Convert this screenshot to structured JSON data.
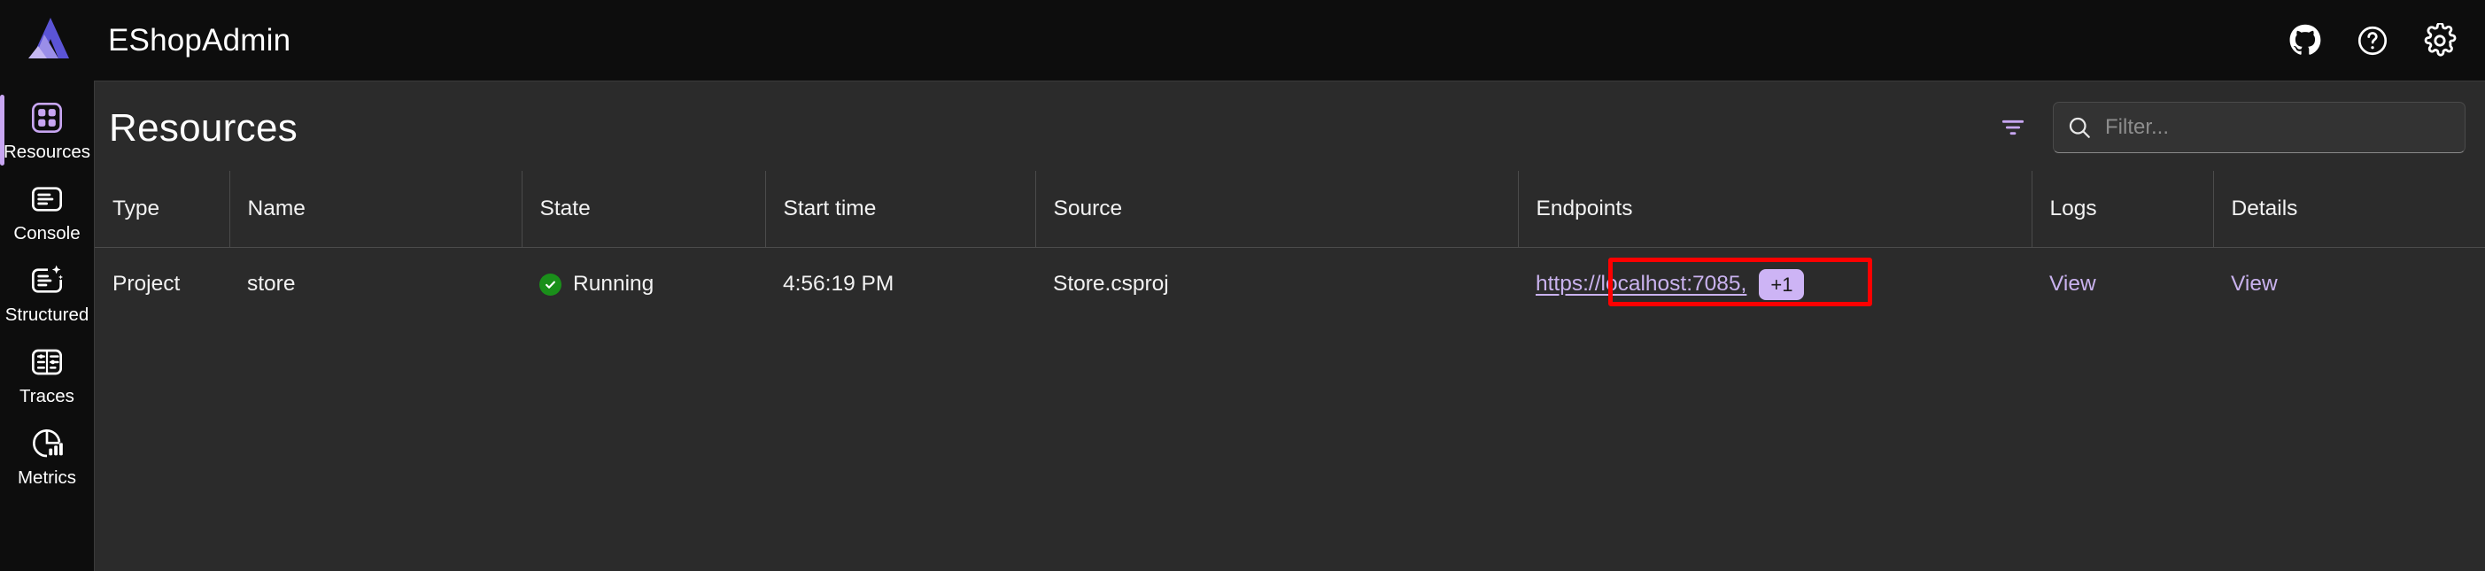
{
  "header": {
    "app_title": "EShopAdmin",
    "logo_name": "aspire-logo",
    "actions": [
      {
        "name": "github-icon",
        "label": "GitHub"
      },
      {
        "name": "help-icon",
        "label": "Help"
      },
      {
        "name": "settings-icon",
        "label": "Settings"
      }
    ]
  },
  "sidebar": {
    "items": [
      {
        "label": "Resources",
        "icon": "resources-icon",
        "active": true
      },
      {
        "label": "Console",
        "icon": "console-icon",
        "active": false
      },
      {
        "label": "Structured",
        "icon": "structured-icon",
        "active": false
      },
      {
        "label": "Traces",
        "icon": "traces-icon",
        "active": false
      },
      {
        "label": "Metrics",
        "icon": "metrics-icon",
        "active": false
      }
    ]
  },
  "page": {
    "title": "Resources",
    "filter_icon": "filter-icon",
    "search": {
      "icon": "search-icon",
      "placeholder": "Filter...",
      "value": ""
    }
  },
  "table": {
    "columns": [
      "Type",
      "Name",
      "State",
      "Start time",
      "Source",
      "Endpoints",
      "Logs",
      "Details"
    ],
    "rows": [
      {
        "type": "Project",
        "name": "store",
        "state": "Running",
        "state_status": "ok",
        "start_time": "4:56:19 PM",
        "source": "Store.csproj",
        "endpoint_url": "https://localhost:7085,",
        "endpoint_more": "+1",
        "logs": "View",
        "details": "View"
      }
    ]
  },
  "highlight": {
    "name": "endpoint-highlight",
    "color": "#fe0000"
  },
  "colors": {
    "accent": "#c8a6f2",
    "link": "#c9b2ee",
    "status_ok": "#1a8f1a",
    "panel_bg": "#2b2b2b",
    "chrome_bg": "#0d0d0d"
  }
}
